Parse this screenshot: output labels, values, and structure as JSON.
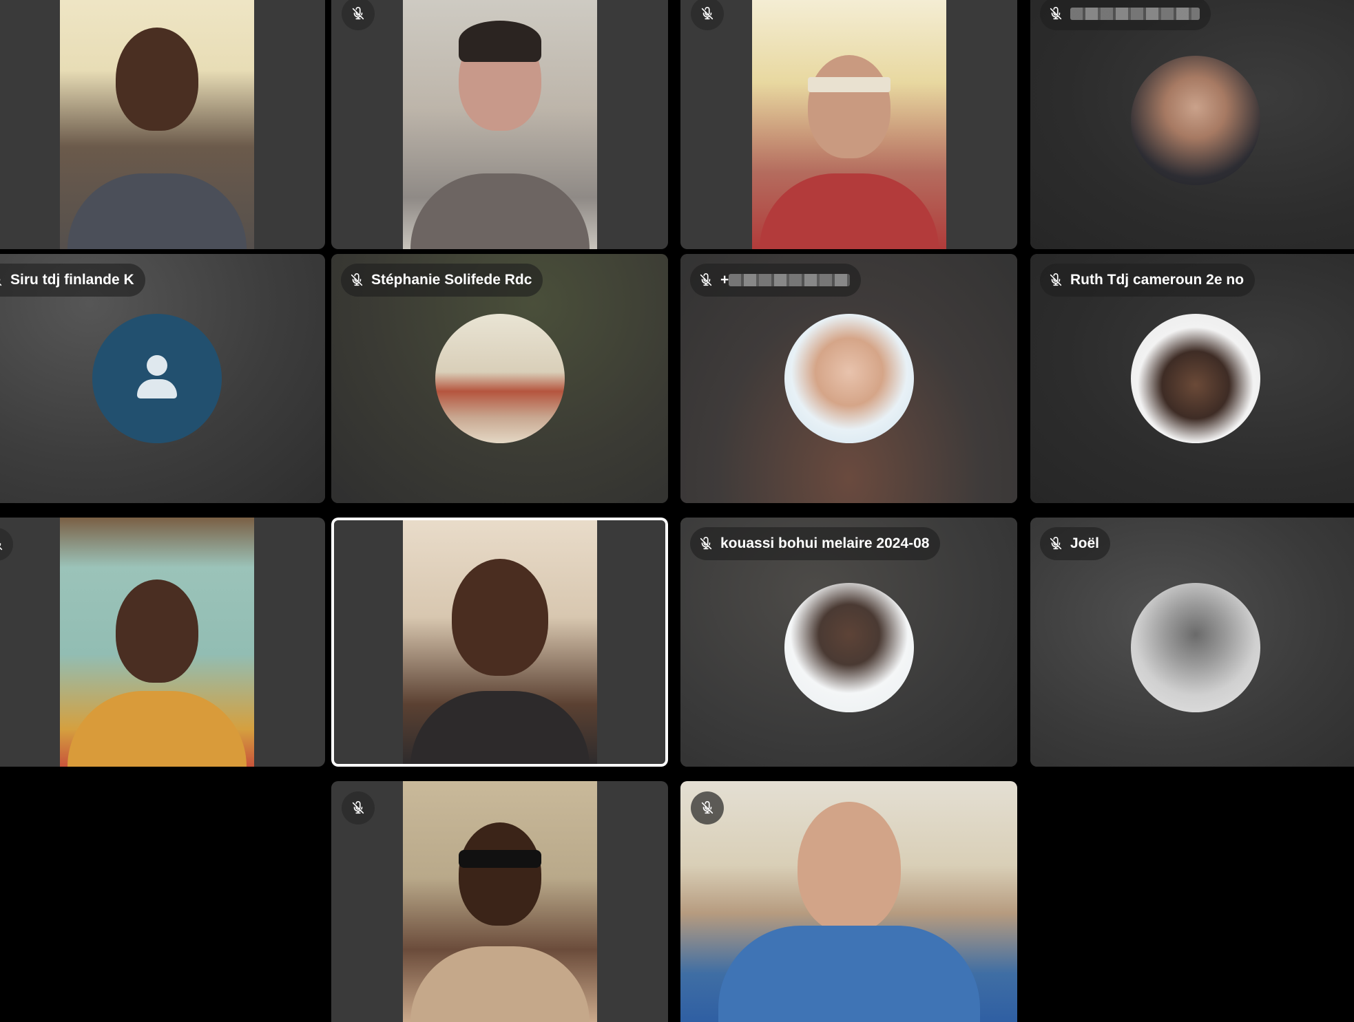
{
  "participants": [
    {
      "id": "p1",
      "name": "",
      "muted": false,
      "mode": "video"
    },
    {
      "id": "p2",
      "name": "",
      "muted": true,
      "mode": "video"
    },
    {
      "id": "p3",
      "name": "",
      "muted": true,
      "mode": "video"
    },
    {
      "id": "p4",
      "name": "",
      "name_redacted": true,
      "muted": true,
      "mode": "avatar"
    },
    {
      "id": "p5",
      "name": "Siru tdj finlande K",
      "muted": true,
      "mode": "avatar"
    },
    {
      "id": "p6",
      "name": "Stéphanie Solifede Rdc",
      "muted": true,
      "mode": "avatar"
    },
    {
      "id": "p7",
      "name": "+",
      "name_redacted": true,
      "muted": true,
      "mode": "avatar"
    },
    {
      "id": "p8",
      "name": "Ruth Tdj cameroun 2e no",
      "muted": true,
      "mode": "avatar"
    },
    {
      "id": "p9",
      "name": "",
      "muted": true,
      "mode": "video"
    },
    {
      "id": "p10",
      "name": "",
      "muted": false,
      "mode": "video",
      "active_speaker": true
    },
    {
      "id": "p11",
      "name": "kouassi bohui melaire 2024-08",
      "muted": true,
      "mode": "avatar"
    },
    {
      "id": "p12",
      "name": "Joël",
      "muted": true,
      "mode": "avatar"
    },
    {
      "id": "p13",
      "name": "",
      "muted": true,
      "mode": "video"
    },
    {
      "id": "p14",
      "name": "",
      "muted": true,
      "mode": "video"
    }
  ],
  "icons": {
    "mic_muted": "mic-off-icon",
    "generic_avatar": "person-icon"
  },
  "colors": {
    "background": "#000000",
    "tile": "#3a3a3a",
    "active_border": "#ffffff",
    "generic_avatar": "#22506f"
  }
}
